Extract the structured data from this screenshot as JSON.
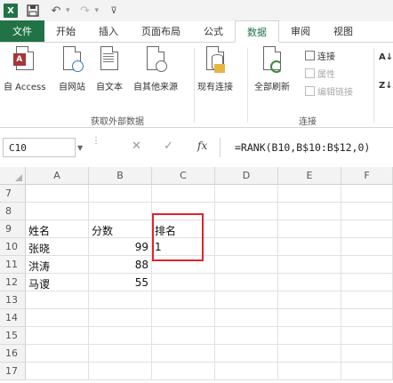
{
  "app": {
    "logo": "X"
  },
  "quick_access": {
    "save_icon": "save-icon",
    "undo_icon": "undo-icon",
    "redo_icon": "redo-icon"
  },
  "tabs": [
    {
      "label": "文件"
    },
    {
      "label": "开始"
    },
    {
      "label": "插入"
    },
    {
      "label": "页面布局"
    },
    {
      "label": "公式"
    },
    {
      "label": "数据",
      "active": true
    },
    {
      "label": "审阅"
    },
    {
      "label": "视图"
    }
  ],
  "ribbon": {
    "get_external_data": {
      "label": "获取外部数据",
      "buttons": [
        {
          "label": "自 Access",
          "icon": "access-db-icon"
        },
        {
          "label": "自网站",
          "icon": "web-icon"
        },
        {
          "label": "自文本",
          "icon": "text-file-icon"
        },
        {
          "label": "自其他来源",
          "icon": "other-sources-icon"
        }
      ]
    },
    "existing_connections": {
      "label": "现有连接",
      "icon": "existing-connections-icon"
    },
    "connections": {
      "label": "连接",
      "refresh_all": {
        "label": "全部刷新",
        "icon": "refresh-all-icon"
      },
      "items": [
        {
          "label": "连接",
          "enabled": true
        },
        {
          "label": "属性",
          "enabled": false
        },
        {
          "label": "编辑链接",
          "enabled": false
        }
      ]
    },
    "sort": {
      "asc": "A↓Z",
      "desc": "Z↓A"
    }
  },
  "formula_bar": {
    "name_box": "C10",
    "cancel": "✕",
    "enter": "✓",
    "fx": "fx",
    "formula": "=RANK(B10,B$10:B$12,0)"
  },
  "sheet": {
    "columns": [
      "A",
      "B",
      "C",
      "D",
      "E",
      "F"
    ],
    "rows": [
      {
        "num": "7",
        "cells": [
          "",
          "",
          "",
          "",
          "",
          ""
        ]
      },
      {
        "num": "8",
        "cells": [
          "",
          "",
          "",
          "",
          "",
          ""
        ]
      },
      {
        "num": "9",
        "cells": [
          "姓名",
          "分数",
          "排名",
          "",
          "",
          ""
        ]
      },
      {
        "num": "10",
        "cells": [
          "张晓",
          "99",
          "1",
          "",
          "",
          ""
        ]
      },
      {
        "num": "11",
        "cells": [
          "洪涛",
          "88",
          "",
          "",
          "",
          ""
        ]
      },
      {
        "num": "12",
        "cells": [
          "马谡",
          "55",
          "",
          "",
          "",
          ""
        ]
      },
      {
        "num": "13",
        "cells": [
          "",
          "",
          "",
          "",
          "",
          ""
        ]
      },
      {
        "num": "14",
        "cells": [
          "",
          "",
          "",
          "",
          "",
          ""
        ]
      },
      {
        "num": "15",
        "cells": [
          "",
          "",
          "",
          "",
          "",
          ""
        ]
      },
      {
        "num": "16",
        "cells": [
          "",
          "",
          "",
          "",
          "",
          ""
        ]
      },
      {
        "num": "17",
        "cells": [
          "",
          "",
          "",
          "",
          "",
          ""
        ]
      }
    ]
  },
  "colors": {
    "excel_green": "#217346",
    "highlight": "#e0242b"
  }
}
